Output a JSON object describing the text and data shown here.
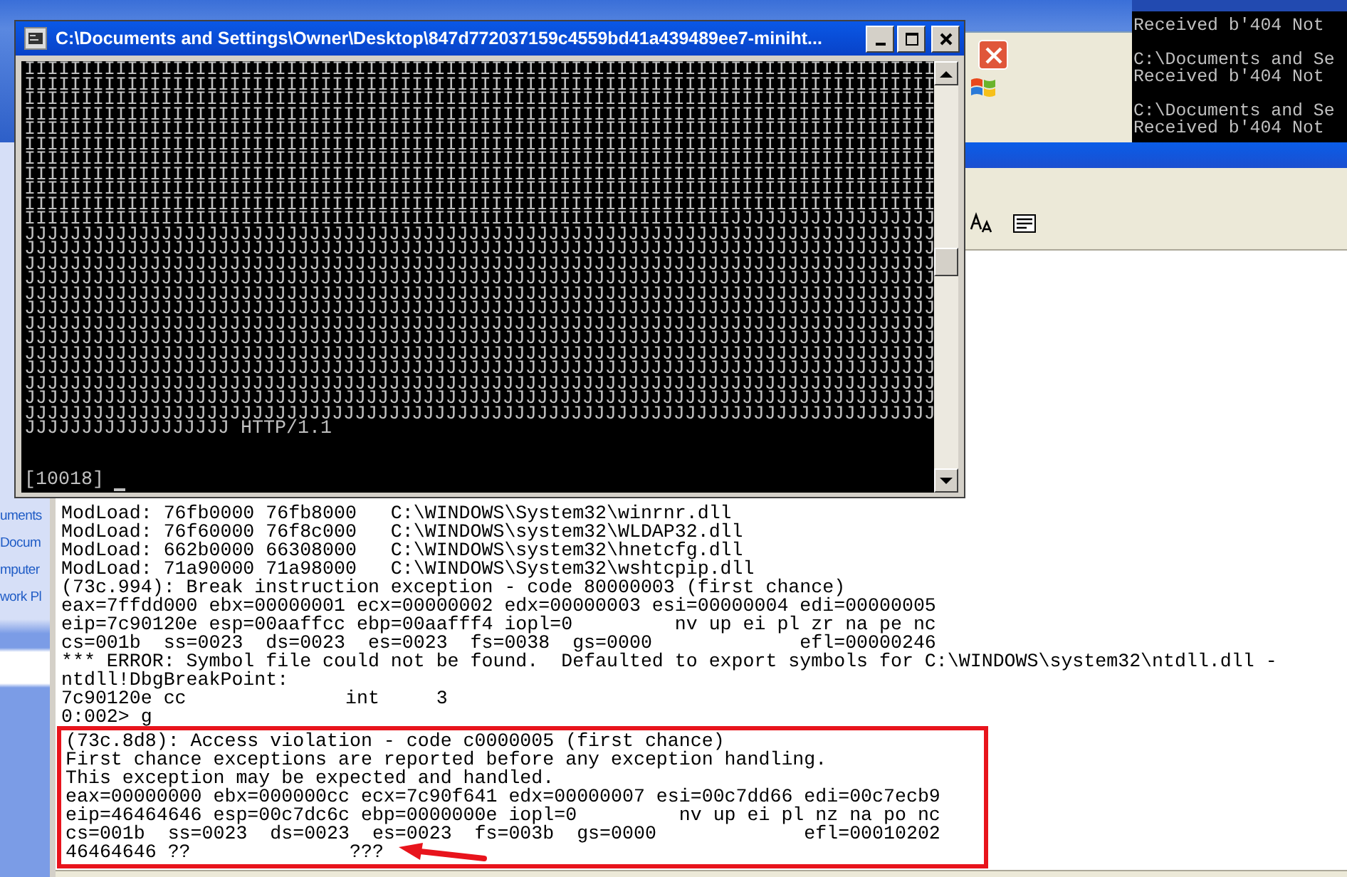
{
  "explorer_sidebar": {
    "links": [
      "uments",
      "Docum",
      "mputer",
      "work Pl"
    ]
  },
  "right_console": {
    "blocks": [
      [
        "Received b'404 Not"
      ],
      [
        "C:\\Documents and Se",
        "Received b'404 Not"
      ],
      [
        "C:\\Documents and Se",
        "Received b'404 Not"
      ]
    ]
  },
  "debugger": {
    "lines": [
      "ModLoad: 76fb0000 76fb8000   C:\\WINDOWS\\System32\\winrnr.dll",
      "ModLoad: 76f60000 76f8c000   C:\\WINDOWS\\system32\\WLDAP32.dll",
      "ModLoad: 662b0000 66308000   C:\\WINDOWS\\system32\\hnetcfg.dll",
      "ModLoad: 71a90000 71a98000   C:\\WINDOWS\\System32\\wshtcpip.dll",
      "(73c.994): Break instruction exception - code 80000003 (first chance)",
      "eax=7ffdd000 ebx=00000001 ecx=00000002 edx=00000003 esi=00000004 edi=00000005",
      "eip=7c90120e esp=00aaffcc ebp=00aafff4 iopl=0         nv up ei pl zr na pe nc",
      "cs=001b  ss=0023  ds=0023  es=0023  fs=0038  gs=0000             efl=00000246",
      "*** ERROR: Symbol file could not be found.  Defaulted to export symbols for C:\\WINDOWS\\system32\\ntdll.dll -",
      "ntdll!DbgBreakPoint:",
      "7c90120e cc              int     3",
      "0:002> g"
    ],
    "highlighted_lines": [
      "(73c.8d8): Access violation - code c0000005 (first chance)",
      "First chance exceptions are reported before any exception handling.",
      "This exception may be expected and handled.",
      "eax=00000000 ebx=000000cc ecx=7c90f641 edx=00000007 esi=00c7dd66 edi=00c7ecb9",
      "eip=46464646 esp=00c7dc6c ebp=0000000e iopl=0         nv up ei pl nz na po nc",
      "cs=001b  ss=0023  ds=0023  es=0023  fs=003b  gs=0000             efl=00010202",
      "46464646 ??              ???"
    ]
  },
  "console": {
    "title": "C:\\Documents and Settings\\Owner\\Desktop\\847d772037159c4559bd41a439489ee7-miniht...",
    "lines": [
      "IIIIIIIIIIIIIIIIIIIIIIIIIIIIIIIIIIIIIIIIIIIIIIIIIIIIIIIIIIIIIIIIIIIIIIIIIIIIIIII",
      "IIIIIIIIIIIIIIIIIIIIIIIIIIIIIIIIIIIIIIIIIIIIIIIIIIIIIIIIIIIIIIIIIIIIIIIIIIIIIIII",
      "IIIIIIIIIIIIIIIIIIIIIIIIIIIIIIIIIIIIIIIIIIIIIIIIIIIIIIIIIIIIIIIIIIIIIIIIIIIIIIII",
      "IIIIIIIIIIIIIIIIIIIIIIIIIIIIIIIIIIIIIIIIIIIIIIIIIIIIIIIIIIIIIIIIIIIIIIIIIIIIIIII",
      "IIIIIIIIIIIIIIIIIIIIIIIIIIIIIIIIIIIIIIIIIIIIIIIIIIIIIIIIIIIIIIIIIIIIIIIIIIIIIIII",
      "IIIIIIIIIIIIIIIIIIIIIIIIIIIIIIIIIIIIIIIIIIIIIIIIIIIIIIIIIIIIIIIIIIIIIIIIIIIIIIII",
      "IIIIIIIIIIIIIIIIIIIIIIIIIIIIIIIIIIIIIIIIIIIIIIIIIIIIIIIIIIIIIIIIIIIIIIIIIIIIIIII",
      "IIIIIIIIIIIIIIIIIIIIIIIIIIIIIIIIIIIIIIIIIIIIIIIIIIIIIIIIIIIIIIIIIIIIIIIIIIIIIIII",
      "IIIIIIIIIIIIIIIIIIIIIIIIIIIIIIIIIIIIIIIIIIIIIIIIIIIIIIIIIIIIIIIIIIIIIIIIIIIIIIII",
      "IIIIIIIIIIIIIIIIIIIIIIIIIIIIIIIIIIIIIIIIIIIIIIIIIIIIIIIIIIIIIIIIIIIIIIIIIIIIIIII",
      "IIIIIIIIIIIIIIIIIIIIIIIIIIIIIIIIIIIIIIIIIIIIIIIIIIIIIIIIIIIIIIJJJJJJJJJJJJJJJJJJ",
      "JJJJJJJJJJJJJJJJJJJJJJJJJJJJJJJJJJJJJJJJJJJJJJJJJJJJJJJJJJJJJJJJJJJJJJJJJJJJJJJJ",
      "JJJJJJJJJJJJJJJJJJJJJJJJJJJJJJJJJJJJJJJJJJJJJJJJJJJJJJJJJJJJJJJJJJJJJJJJJJJJJJJJ",
      "JJJJJJJJJJJJJJJJJJJJJJJJJJJJJJJJJJJJJJJJJJJJJJJJJJJJJJJJJJJJJJJJJJJJJJJJJJJJJJJJ",
      "JJJJJJJJJJJJJJJJJJJJJJJJJJJJJJJJJJJJJJJJJJJJJJJJJJJJJJJJJJJJJJJJJJJJJJJJJJJJJJJJ",
      "JJJJJJJJJJJJJJJJJJJJJJJJJJJJJJJJJJJJJJJJJJJJJJJJJJJJJJJJJJJJJJJJJJJJJJJJJJJJJJJJ",
      "JJJJJJJJJJJJJJJJJJJJJJJJJJJJJJJJJJJJJJJJJJJJJJJJJJJJJJJJJJJJJJJJJJJJJJJJJJJJJJJJ",
      "JJJJJJJJJJJJJJJJJJJJJJJJJJJJJJJJJJJJJJJJJJJJJJJJJJJJJJJJJJJJJJJJJJJJJJJJJJJJJJJJ",
      "JJJJJJJJJJJJJJJJJJJJJJJJJJJJJJJJJJJJJJJJJJJJJJJJJJJJJJJJJJJJJJJJJJJJJJJJJJJJJJJJ",
      "JJJJJJJJJJJJJJJJJJJJJJJJJJJJJJJJJJJJJJJJJJJJJJJJJJJJJJJJJJJJJJJJJJJJJJJJJJJJJJJJ",
      "JJJJJJJJJJJJJJJJJJJJJJJJJJJJJJJJJJJJJJJJJJJJJJJJJJJJJJJJJJJJJJJJJJJJJJJJJJJJJJJJ",
      "JJJJJJJJJJJJJJJJJJJJJJJJJJJJJJJJJJJJJJJJJJJJJJJJJJJJJJJJJJJJJJJJJJJJJJJJJJJJJJJJ",
      "JJJJJJJJJJJJJJJJJJJJJJJJJJJJJJJJJJJJJJJJJJJJJJJJJJJJJJJJJJJJJJJJJJJJJJJJJJJJJJJJ",
      "JJJJJJJJJJJJJJJJJJJJJJJJJJJJJJJJJJJJJJJJJJJJJJJJJJJJJJJJJJJJJJJJJJJJJJJJJJJJJJJJ",
      "JJJJJJJJJJJJJJJJJJ HTTP/1.1"
    ],
    "prompt": "[10018]"
  }
}
